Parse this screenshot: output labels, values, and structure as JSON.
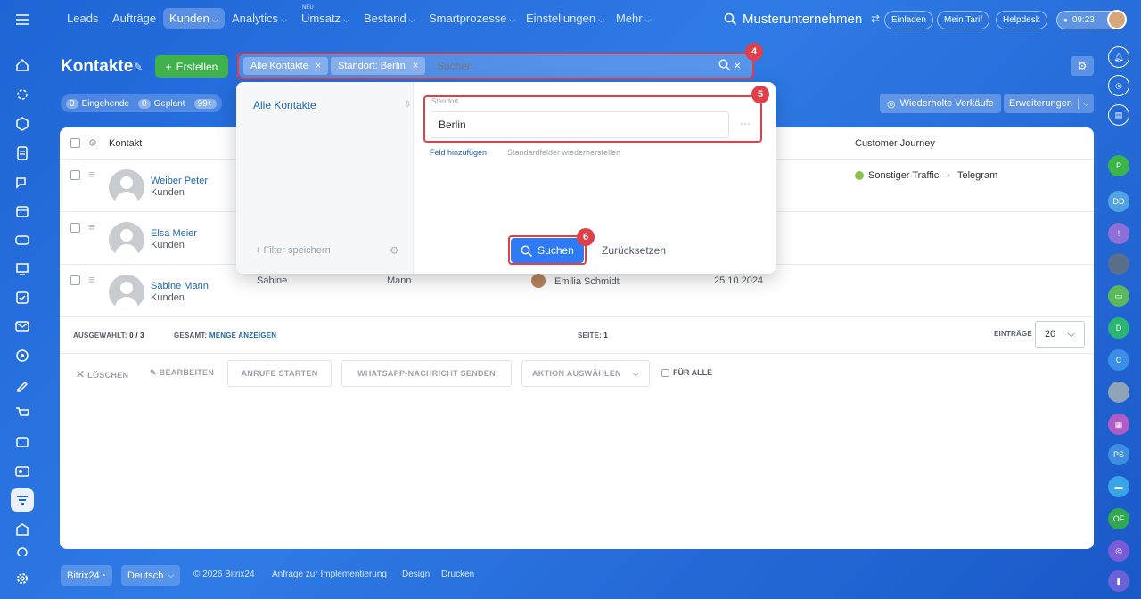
{
  "topnav": {
    "items": [
      {
        "label": "Leads",
        "dropdown": false
      },
      {
        "label": "Aufträge",
        "dropdown": false
      },
      {
        "label": "Kunden",
        "dropdown": true,
        "active": true
      },
      {
        "label": "Analytics",
        "dropdown": true
      },
      {
        "label": "Umsatz",
        "dropdown": true,
        "badge": "NEU"
      },
      {
        "label": "Bestand",
        "dropdown": true
      },
      {
        "label": "Smartprozesse",
        "dropdown": true
      },
      {
        "label": "Einstellungen",
        "dropdown": true
      },
      {
        "label": "Mehr",
        "dropdown": true
      }
    ],
    "company": "Musterunternehmen",
    "invite": "Einladen",
    "tariff": "Mein Tarif",
    "helpdesk": "Helpdesk",
    "time": "09:23"
  },
  "header": {
    "title": "Kontakte",
    "create_label": "Erstellen",
    "repeat_sales": "Wiederholte Verkäufe",
    "extensions": "Erweiterungen"
  },
  "counters": [
    {
      "count": "0",
      "label": "Eingehende"
    },
    {
      "count": "0",
      "label": "Geplant"
    },
    {
      "count": "99+",
      "label": ""
    }
  ],
  "filter": {
    "chips": [
      "Alle Kontakte",
      "Standort: Berlin"
    ],
    "placeholder": "Suchen"
  },
  "annotations": {
    "a4": "4",
    "a5": "5",
    "a6": "6"
  },
  "dropdown": {
    "preset": "Alle Kontakte",
    "field_label": "Standort",
    "field_value": "Berlin",
    "add_field": "Feld hinzufügen",
    "restore_fields": "Standardfelder wiederherstellen",
    "save_filter": "Filter speichern",
    "search_button": "Suchen",
    "reset_button": "Zurücksetzen"
  },
  "table": {
    "headers": {
      "contact": "Kontakt",
      "journey": "Customer Journey"
    },
    "rows": [
      {
        "name": "Weiber Peter",
        "type": "Kunden",
        "first": "",
        "last": "",
        "responsible": "",
        "date": "",
        "journey_source": "Sonstiger Traffic",
        "journey_target": "Telegram"
      },
      {
        "name": "Elsa Meier",
        "type": "Kunden",
        "first": "",
        "last": "",
        "responsible": "",
        "date": "",
        "journey_source": "",
        "journey_target": ""
      },
      {
        "name": "Sabine Mann",
        "type": "Kunden",
        "first": "Sabine",
        "last": "Mann",
        "responsible": "Emilia Schmidt",
        "date": "25.10.2024",
        "journey_source": "",
        "journey_target": ""
      }
    ]
  },
  "summary": {
    "selected_label": "AUSGEWÄHLT:",
    "selected_value": "0 / 3",
    "total_label": "GESAMT:",
    "total_link": "MENGE ANZEIGEN",
    "page_label": "SEITE:",
    "page_value": "1",
    "entries_label": "EINTRÄGE",
    "entries_value": "20"
  },
  "actions": {
    "delete": "LÖSCHEN",
    "edit": "BEARBEITEN",
    "calls": "ANRUFE STARTEN",
    "whatsapp": "WHATSAPP-NACHRICHT SENDEN",
    "choose": "AKTION AUSWÄHLEN",
    "for_all": "FÜR ALLE"
  },
  "footer": {
    "brand": "Bitrix24",
    "language": "Deutsch",
    "copyright": "© 2026 Bitrix24",
    "implementation": "Anfrage zur Implementierung",
    "design": "Design",
    "print": "Drucken"
  },
  "rightrail": {
    "initials": [
      "P",
      "DD",
      "",
      "",
      "",
      "D",
      "C",
      "",
      "",
      "PS",
      "",
      "OF",
      "",
      ""
    ]
  },
  "colors": {
    "accent": "#2fc6f6",
    "primary_button": "#2e7bf5",
    "create_button": "#3fb24b",
    "annotation": "#e0404a"
  }
}
